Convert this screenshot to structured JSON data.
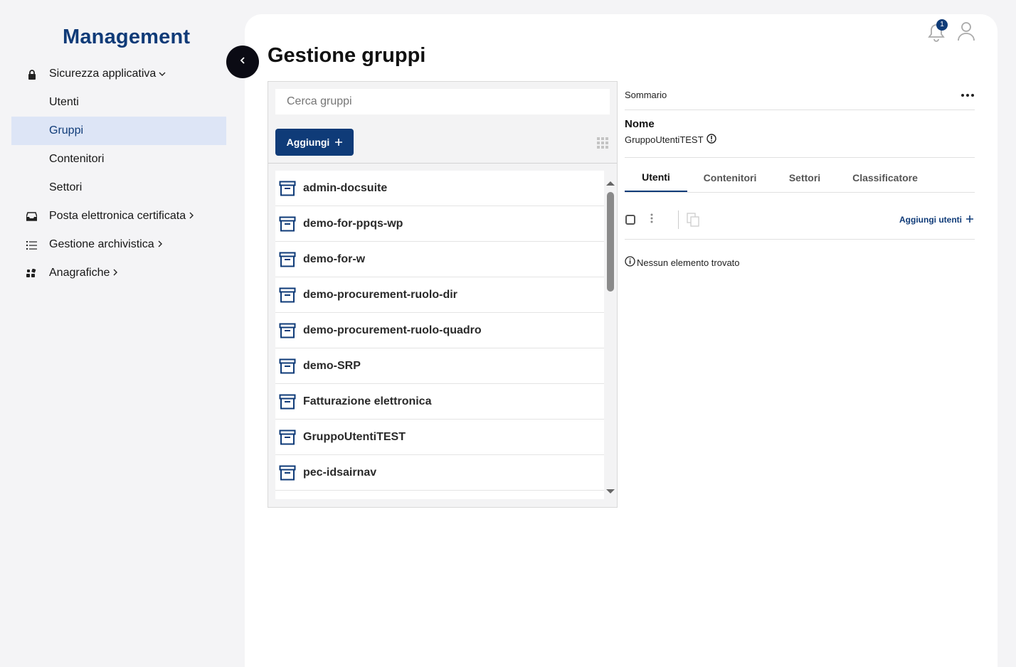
{
  "sidebar": {
    "brand": "Management",
    "items": [
      {
        "label": "Sicurezza applicativa",
        "icon": "lock-icon",
        "chevron": "⌄"
      },
      {
        "label": "Utenti"
      },
      {
        "label": "Gruppi"
      },
      {
        "label": "Contenitori"
      },
      {
        "label": "Settori"
      },
      {
        "label": "Posta elettronica certificata",
        "icon": "inbox-icon",
        "chevron": "›"
      },
      {
        "label": "Gestione archivistica",
        "icon": "list-icon",
        "chevron": "›"
      },
      {
        "label": "Anagrafiche",
        "icon": "apps-icon",
        "chevron": "›"
      }
    ]
  },
  "header": {
    "title": "Gestione gruppi",
    "notification_count": "1"
  },
  "list_panel": {
    "search_placeholder": "Cerca gruppi",
    "add_label": "Aggiungi",
    "groups": [
      "admin-docsuite",
      "demo-for-ppqs-wp",
      "demo-for-w",
      "demo-procurement-ruolo-dir",
      "demo-procurement-ruolo-quadro",
      "demo-SRP",
      "Fatturazione elettronica",
      "GruppoUtentiTEST",
      "pec-idsairnav"
    ]
  },
  "detail": {
    "summary_label": "Sommario",
    "name_label": "Nome",
    "name_value": "GruppoUtentiTEST",
    "tabs": [
      "Utenti",
      "Contenitori",
      "Settori",
      "Classificatore"
    ],
    "add_users_label": "Aggiungi utenti",
    "empty_message": "Nessun elemento trovato"
  },
  "colors": {
    "accent": "#0f3b78",
    "active_bg": "#dde5f6"
  }
}
